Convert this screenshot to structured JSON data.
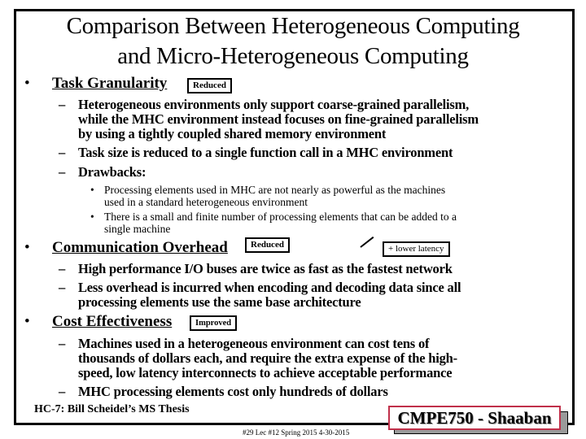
{
  "slide": {
    "title_line1": "Comparison Between Heterogeneous Computing",
    "title_line2": "and Micro-Heterogeneous Computing",
    "sections": [
      {
        "heading": "Task Granularity",
        "tag": "Reduced",
        "items": [
          {
            "lines": [
              "Heterogeneous environments only support coarse-grained parallelism,",
              "while the MHC environment instead focuses on fine-grained parallelism",
              "by using a tightly coupled shared memory environment"
            ]
          },
          {
            "lines": [
              "Task size is reduced to a single function call in a MHC environment"
            ]
          },
          {
            "lines": [
              "Drawbacks:"
            ],
            "subitems": [
              {
                "lines": [
                  "Processing elements used in MHC are not nearly as powerful as the machines",
                  "used in a standard heterogeneous environment"
                ]
              },
              {
                "lines": [
                  "There is a small and finite number of processing elements that can be added to a",
                  "single machine"
                ]
              }
            ]
          }
        ]
      },
      {
        "heading": "Communication Overhead",
        "tag": "Reduced",
        "callout": "+ lower latency",
        "items": [
          {
            "lines": [
              "High performance I/O buses are twice as fast as the fastest network"
            ]
          },
          {
            "lines": [
              "Less overhead is incurred when encoding and decoding data since all",
              "processing elements use the same base architecture"
            ]
          }
        ]
      },
      {
        "heading": "Cost Effectiveness",
        "tag": "Improved",
        "items": [
          {
            "lines": [
              "Machines used in a heterogeneous environment can cost tens of",
              "thousands of dollars each, and require the extra expense of the high-",
              "speed, low latency interconnects to achieve acceptable performance"
            ]
          },
          {
            "lines": [
              "MHC processing elements cost only hundreds of dollars"
            ]
          }
        ]
      }
    ],
    "bullet_glyph": "•",
    "dash_glyph": "–",
    "footer_note": "HC-7: Bill Scheidel’s MS Thesis",
    "slide_info": "#29  Lec #12   Spring 2015  4-30-2015",
    "badge": "CMPE750 - Shaaban",
    "colors": {
      "badge_border": "#c0304a",
      "badge_shadow": "#9a9a9a",
      "text": "#000000"
    }
  }
}
